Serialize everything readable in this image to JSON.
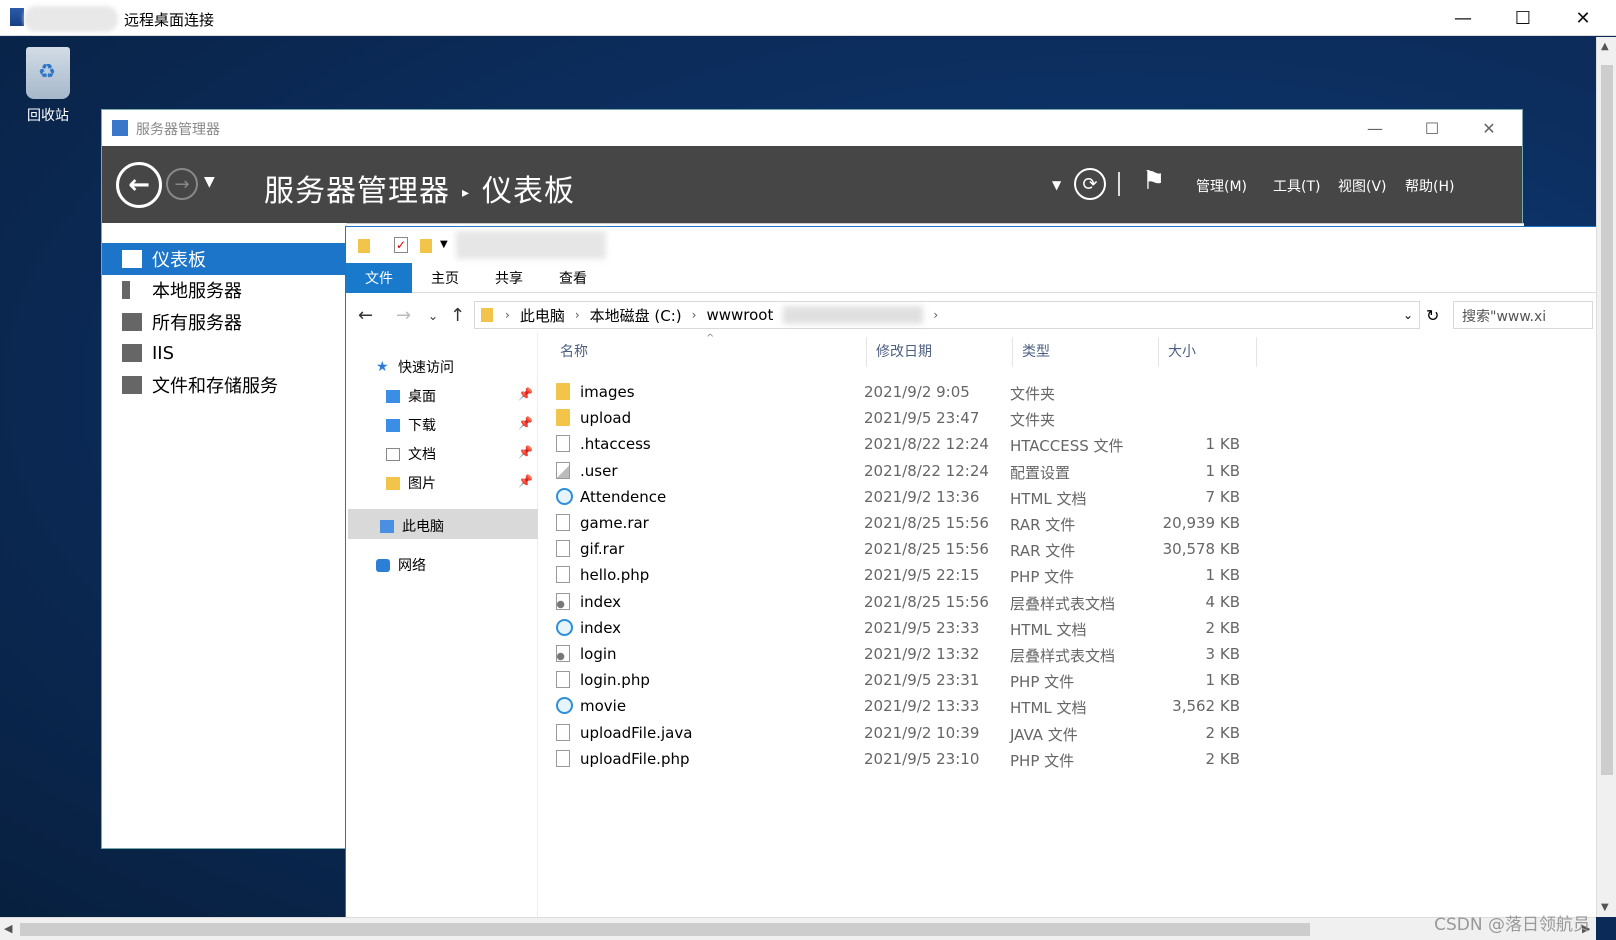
{
  "rdp": {
    "title": "远程桌面连接",
    "minimize": "—",
    "maximize": "☐",
    "close": "✕"
  },
  "desktop": {
    "recycle_bin_label": "回收站"
  },
  "server_manager": {
    "window_title": "服务器管理器",
    "breadcrumb_root": "服务器管理器",
    "breadcrumb_sep": "▸",
    "breadcrumb_page": "仪表板",
    "menus": [
      "管理(M)",
      "工具(T)",
      "视图(V)",
      "帮助(H)"
    ],
    "sidebar": [
      {
        "label": "仪表板",
        "active": true,
        "icon": "dashboard-icon"
      },
      {
        "label": "本地服务器",
        "active": false,
        "icon": "server-icon"
      },
      {
        "label": "所有服务器",
        "active": false,
        "icon": "servers-icon"
      },
      {
        "label": "IIS",
        "active": false,
        "icon": "iis-icon"
      },
      {
        "label": "文件和存储服务",
        "active": false,
        "icon": "storage-icon"
      }
    ]
  },
  "explorer": {
    "tabs": [
      "文件",
      "主页",
      "共享",
      "查看"
    ],
    "address": [
      "此电脑",
      "本地磁盘 (C:)",
      "wwwroot"
    ],
    "search_placeholder": "搜索\"www.xi",
    "nav": {
      "quick_access": "快速访问",
      "desktop": "桌面",
      "downloads": "下载",
      "documents": "文档",
      "pictures": "图片",
      "this_pc": "此电脑",
      "network": "网络"
    },
    "columns": {
      "name": "名称",
      "date": "修改日期",
      "type": "类型",
      "size": "大小"
    },
    "files": [
      {
        "name": "images",
        "date": "2021/9/2 9:05",
        "type": "文件夹",
        "size": "",
        "icon": "folder"
      },
      {
        "name": "upload",
        "date": "2021/9/5 23:47",
        "type": "文件夹",
        "size": "",
        "icon": "folder"
      },
      {
        "name": ".htaccess",
        "date": "2021/8/22 12:24",
        "type": "HTACCESS 文件",
        "size": "1 KB",
        "icon": "file"
      },
      {
        "name": ".user",
        "date": "2021/8/22 12:24",
        "type": "配置设置",
        "size": "1 KB",
        "icon": "cfg"
      },
      {
        "name": "Attendence",
        "date": "2021/9/2 13:36",
        "type": "HTML 文档",
        "size": "7 KB",
        "icon": "html"
      },
      {
        "name": "game.rar",
        "date": "2021/8/25 15:56",
        "type": "RAR 文件",
        "size": "20,939 KB",
        "icon": "file"
      },
      {
        "name": "gif.rar",
        "date": "2021/8/25 15:56",
        "type": "RAR 文件",
        "size": "30,578 KB",
        "icon": "file"
      },
      {
        "name": "hello.php",
        "date": "2021/9/5 22:15",
        "type": "PHP 文件",
        "size": "1 KB",
        "icon": "file"
      },
      {
        "name": "index",
        "date": "2021/8/25 15:56",
        "type": "层叠样式表文档",
        "size": "4 KB",
        "icon": "css"
      },
      {
        "name": "index",
        "date": "2021/9/5 23:33",
        "type": "HTML 文档",
        "size": "2 KB",
        "icon": "html"
      },
      {
        "name": "login",
        "date": "2021/9/2 13:32",
        "type": "层叠样式表文档",
        "size": "3 KB",
        "icon": "css"
      },
      {
        "name": "login.php",
        "date": "2021/9/5 23:31",
        "type": "PHP 文件",
        "size": "1 KB",
        "icon": "file"
      },
      {
        "name": "movie",
        "date": "2021/9/2 13:33",
        "type": "HTML 文档",
        "size": "3,562 KB",
        "icon": "html"
      },
      {
        "name": "uploadFile.java",
        "date": "2021/9/2 10:39",
        "type": "JAVA 文件",
        "size": "2 KB",
        "icon": "file"
      },
      {
        "name": "uploadFile.php",
        "date": "2021/9/5 23:10",
        "type": "PHP 文件",
        "size": "2 KB",
        "icon": "file"
      }
    ]
  },
  "watermark": "CSDN @落日领航员"
}
